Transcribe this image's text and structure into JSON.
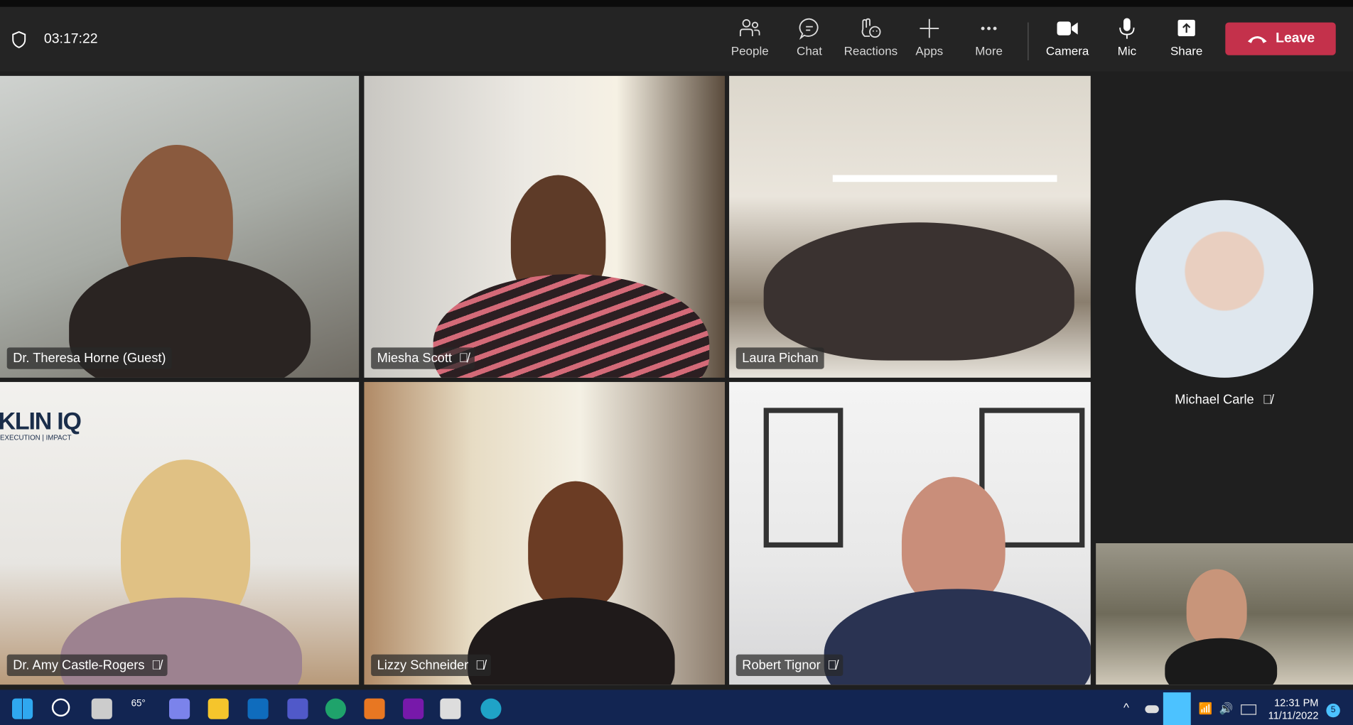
{
  "toolbar": {
    "timer": "03:17:22",
    "buttons": [
      {
        "label": "People",
        "icon": "people-icon"
      },
      {
        "label": "Chat",
        "icon": "chat-icon"
      },
      {
        "label": "Reactions",
        "icon": "reactions-icon"
      },
      {
        "label": "Apps",
        "icon": "plus-icon"
      },
      {
        "label": "More",
        "icon": "more-icon"
      },
      {
        "label": "Camera",
        "icon": "camera-icon"
      },
      {
        "label": "Mic",
        "icon": "mic-icon"
      },
      {
        "label": "Share",
        "icon": "share-icon"
      }
    ],
    "leave": "Leave",
    "leave_color": "#c4314b"
  },
  "participants": [
    {
      "name": "Dr. Theresa Horne (Guest)",
      "muted": false
    },
    {
      "name": "Miesha Scott",
      "muted": true
    },
    {
      "name": "Laura Pichan",
      "muted": false
    },
    {
      "name": "Dr. Amy Castle-Rogers",
      "muted": true
    },
    {
      "name": "Lizzy Schneider",
      "muted": true
    },
    {
      "name": "Robert Tignor",
      "muted": true
    }
  ],
  "spotlight": {
    "name": "Michael Carle",
    "muted": true
  },
  "background_logo": {
    "text": "KLIN IQ",
    "sub": "EXECUTION | IMPACT"
  },
  "taskbar": {
    "weather": "65°",
    "time": "12:31 PM",
    "date": "11/11/2022",
    "notifications": "5"
  }
}
